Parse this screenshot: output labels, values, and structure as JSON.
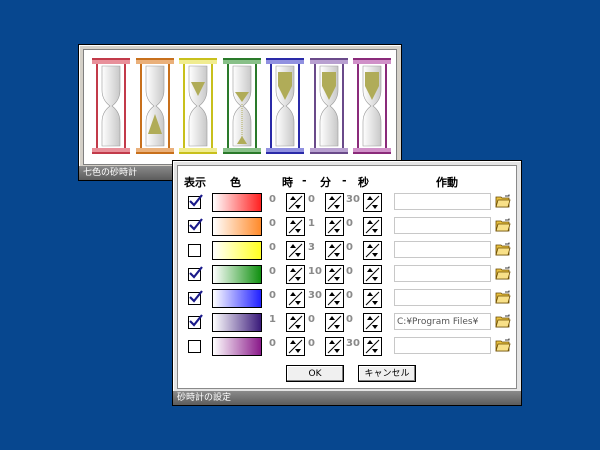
{
  "hourglass_window": {
    "title": "七色の砂時計",
    "hourglasses": [
      {
        "name": "red",
        "frame": "#c23a4a",
        "cap": "#e8909a",
        "sand": "none"
      },
      {
        "name": "orange",
        "frame": "#c8701c",
        "cap": "#eab07a",
        "sand": "bottom"
      },
      {
        "name": "yellow",
        "frame": "#c8c01c",
        "cap": "#f0ec90",
        "sand": "top-small"
      },
      {
        "name": "green",
        "frame": "#2a7a2a",
        "cap": "#88c088",
        "sand": "flowing"
      },
      {
        "name": "blue",
        "frame": "#2a2aa8",
        "cap": "#9090e0",
        "sand": "top"
      },
      {
        "name": "indigo",
        "frame": "#6a4a8a",
        "cap": "#b8a0d0",
        "sand": "top"
      },
      {
        "name": "violet",
        "frame": "#8a2a7a",
        "cap": "#d090c8",
        "sand": "top"
      }
    ]
  },
  "settings_dialog": {
    "title": "砂時計の設定",
    "headers": {
      "show": "表示",
      "color": "色",
      "hour": "時",
      "sep1": "-",
      "minute": "分",
      "sep2": "-",
      "second": "秒",
      "action": "作動"
    },
    "rows": [
      {
        "checked": true,
        "color_from": "#ffffff",
        "color_to": "#ff2020",
        "hour": "0",
        "minute": "0",
        "second": "30",
        "action": ""
      },
      {
        "checked": true,
        "color_from": "#ffffff",
        "color_to": "#ff8a2a",
        "hour": "0",
        "minute": "1",
        "second": "0",
        "action": ""
      },
      {
        "checked": false,
        "color_from": "#ffffff",
        "color_to": "#ffff20",
        "hour": "0",
        "minute": "3",
        "second": "0",
        "action": ""
      },
      {
        "checked": true,
        "color_from": "#ffffff",
        "color_to": "#109010",
        "hour": "0",
        "minute": "10",
        "second": "0",
        "action": ""
      },
      {
        "checked": true,
        "color_from": "#ffffff",
        "color_to": "#2020ff",
        "hour": "0",
        "minute": "30",
        "second": "0",
        "action": ""
      },
      {
        "checked": true,
        "color_from": "#ffffff",
        "color_to": "#3a1a7a",
        "hour": "1",
        "minute": "0",
        "second": "0",
        "action": "C:¥Program Files¥"
      },
      {
        "checked": false,
        "color_from": "#ffffff",
        "color_to": "#8a1a8a",
        "hour": "0",
        "minute": "0",
        "second": "30",
        "action": ""
      }
    ],
    "ok_label": "OK",
    "cancel_label": "キャンセル"
  }
}
